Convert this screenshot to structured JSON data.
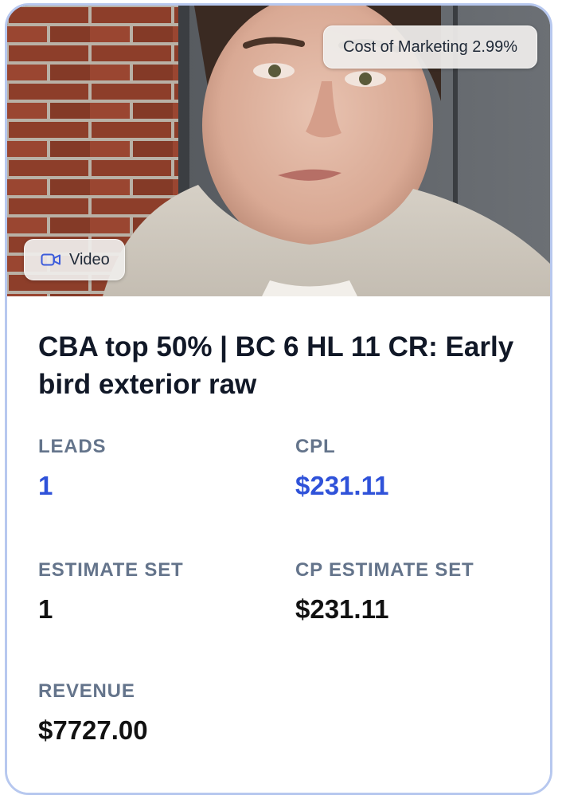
{
  "card": {
    "cost_badge": "Cost of Marketing 2.99%",
    "media_type": {
      "icon": "video-camera-icon",
      "label": "Video"
    },
    "title": "CBA top 50% | BC 6 HL 11 CR: Early bird exterior raw",
    "metrics": {
      "leads": {
        "label": "LEADS",
        "value": "1"
      },
      "cpl": {
        "label": "CPL",
        "value": "$231.11"
      },
      "estimate_set": {
        "label": "ESTIMATE SET",
        "value": "1"
      },
      "cp_estimate_set": {
        "label": "CP ESTIMATE SET",
        "value": "$231.11"
      },
      "revenue": {
        "label": "REVENUE",
        "value": "$7727.00"
      }
    }
  },
  "colors": {
    "card_border": "#b7c8ef",
    "accent_value": "#2f52d9",
    "label_gray": "#64748b",
    "title_text": "#111827"
  }
}
